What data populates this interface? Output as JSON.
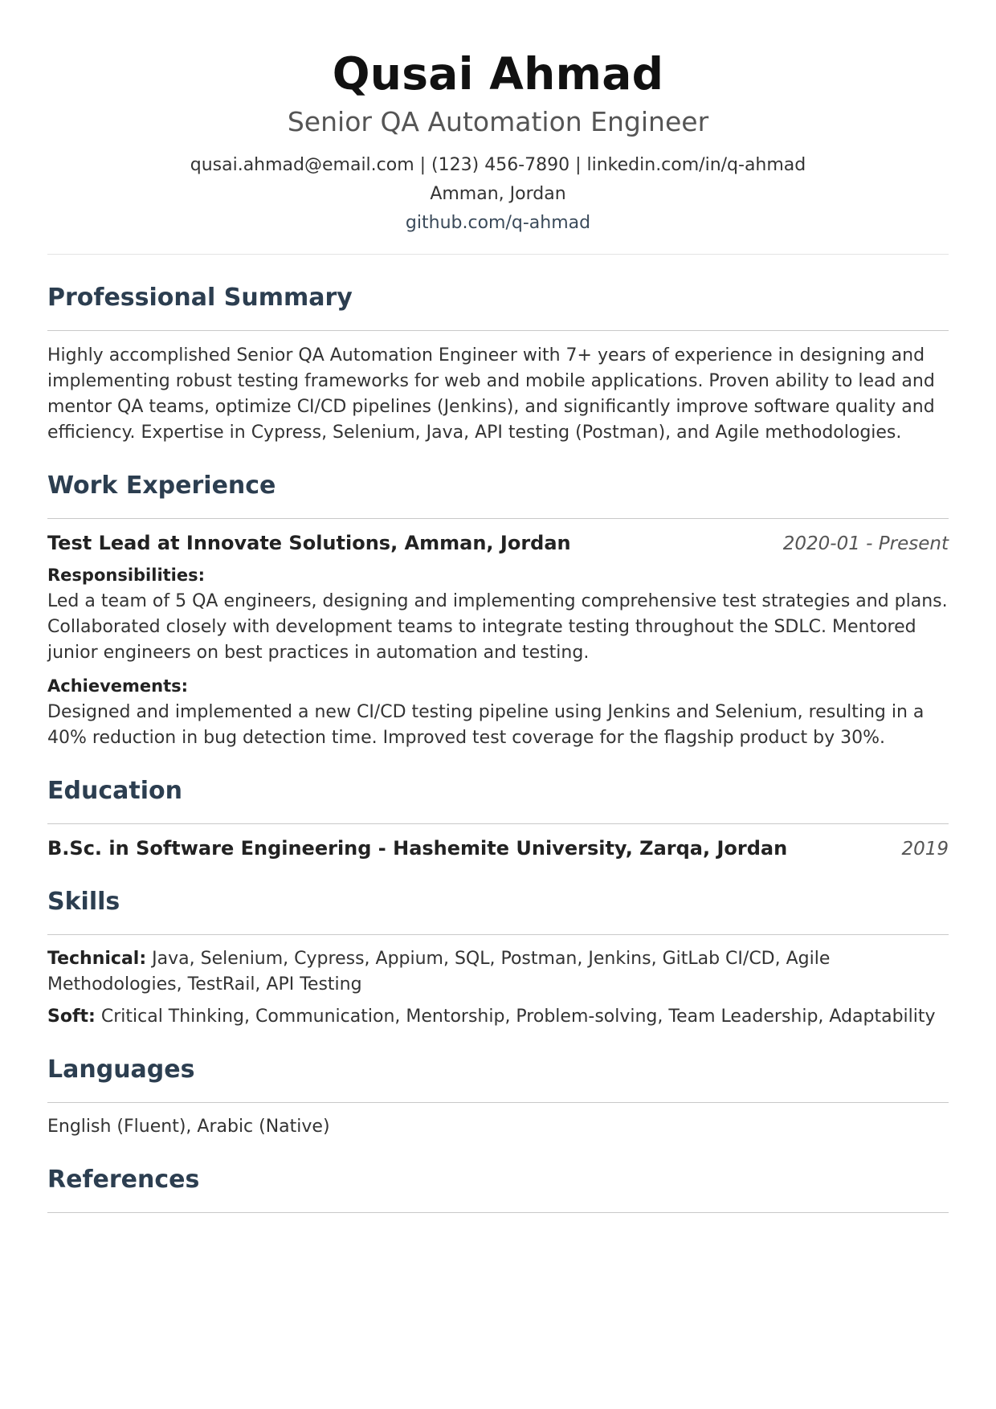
{
  "header": {
    "name": "Qusai Ahmad",
    "title": "Senior QA Automation Engineer",
    "contact_line": "qusai.ahmad@email.com | (123) 456-7890 | linkedin.com/in/q-ahmad",
    "location": "Amman, Jordan",
    "github": "github.com/q-ahmad"
  },
  "summary": {
    "heading": "Professional Summary",
    "text": "Highly accomplished Senior QA Automation Engineer with 7+ years of experience in designing and implementing robust testing frameworks for web and mobile applications. Proven ability to lead and mentor QA teams, optimize CI/CD pipelines (Jenkins), and significantly improve software quality and efficiency. Expertise in Cypress, Selenium, Java, API testing (Postman), and Agile methodologies."
  },
  "experience": {
    "heading": "Work Experience",
    "job_title": "Test Lead at Innovate Solutions, Amman, Jordan",
    "dates": "2020-01 - Present",
    "responsibilities_label": "Responsibilities:",
    "responsibilities": "Led a team of 5 QA engineers, designing and implementing comprehensive test strategies and plans. Collaborated closely with development teams to integrate testing throughout the SDLC. Mentored junior engineers on best practices in automation and testing.",
    "achievements_label": "Achievements:",
    "achievements": "Designed and implemented a new CI/CD testing pipeline using Jenkins and Selenium, resulting in a 40% reduction in bug detection time. Improved test coverage for the flagship product by 30%."
  },
  "education": {
    "heading": "Education",
    "degree": "B.Sc. in Software Engineering - Hashemite University, Zarqa, Jordan",
    "year": "2019"
  },
  "skills": {
    "heading": "Skills",
    "technical_label": "Technical:",
    "technical": "Java, Selenium, Cypress, Appium, SQL, Postman, Jenkins, GitLab CI/CD, Agile Methodologies, TestRail, API Testing",
    "soft_label": "Soft:",
    "soft": "Critical Thinking, Communication, Mentorship, Problem-solving, Team Leadership, Adaptability"
  },
  "languages": {
    "heading": "Languages",
    "text": "English (Fluent), Arabic (Native)"
  },
  "references": {
    "heading": "References"
  }
}
